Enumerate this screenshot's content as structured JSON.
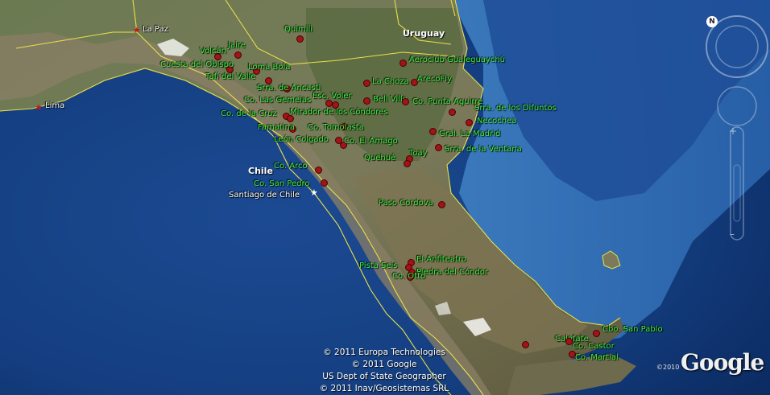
{
  "places": {
    "countries": [
      {
        "label": "Uruguay"
      },
      {
        "label": "Chile"
      }
    ],
    "cities": [
      {
        "label": "La Paz"
      },
      {
        "label": "Lima"
      },
      {
        "label": "Santiago de Chile"
      }
    ],
    "sites": [
      {
        "label": "Quimili"
      },
      {
        "label": "Jaire"
      },
      {
        "label": "Volcán"
      },
      {
        "label": "Cuesta del Obispo"
      },
      {
        "label": "Loma Bola"
      },
      {
        "label": "Tafí del Valle"
      },
      {
        "label": "Srra. de Ancasti"
      },
      {
        "label": "Esc. Voler"
      },
      {
        "label": "Co. Las Gemelas"
      },
      {
        "label": "Co. de la Cruz"
      },
      {
        "label": "Mirador de los Cóndores"
      },
      {
        "label": "Famatina"
      },
      {
        "label": "Co. Tomolasta"
      },
      {
        "label": "León Colgado"
      },
      {
        "label": "Co. El Amago"
      },
      {
        "label": "Aeroclub Gualeguaychú"
      },
      {
        "label": "La Choza"
      },
      {
        "label": "ArecoFly"
      },
      {
        "label": "Bell Ville"
      },
      {
        "label": "Co. Punta Aguirre"
      },
      {
        "label": "Srra. de los Difuntos"
      },
      {
        "label": "Necochea"
      },
      {
        "label": "Gral. La Madrid"
      },
      {
        "label": "Srra. de la Ventana"
      },
      {
        "label": "Toay"
      },
      {
        "label": "Quehué"
      },
      {
        "label": "Co. Arco"
      },
      {
        "label": "Co. San Pedro"
      },
      {
        "label": "Paso Cordova"
      },
      {
        "label": "El Anfiteatro"
      },
      {
        "label": "Pista Seis"
      },
      {
        "label": "Piedra del Cóndor"
      },
      {
        "label": "Co. Otto"
      },
      {
        "label": "Cbo. San Pablo"
      },
      {
        "label": "Calafate"
      },
      {
        "label": "Co. Castor"
      },
      {
        "label": "Co. Martial"
      }
    ]
  },
  "attribution": {
    "lines": [
      "© 2011 Europa Technologies",
      "© 2011 Google",
      "US Dept of State Geographer",
      "© 2011 Inav/Geosistemas SRL"
    ]
  },
  "branding": {
    "logo_text": "Google",
    "year": "©2010"
  }
}
